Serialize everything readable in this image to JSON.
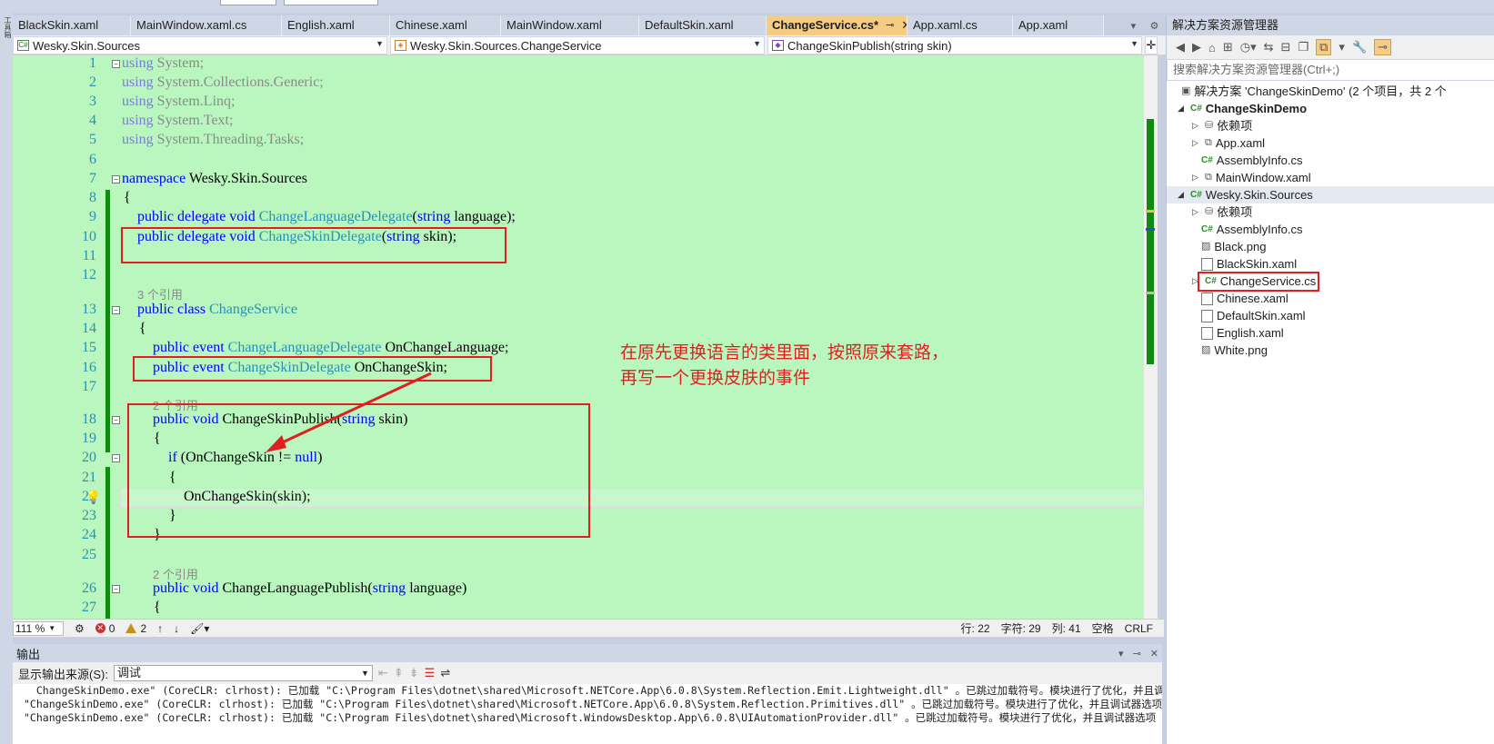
{
  "window": {
    "left_toolbar_label": "工具箱"
  },
  "tabs": [
    {
      "label": "BlackSkin.xaml",
      "active": false
    },
    {
      "label": "MainWindow.xaml.cs",
      "active": false
    },
    {
      "label": "English.xaml",
      "active": false
    },
    {
      "label": "Chinese.xaml",
      "active": false
    },
    {
      "label": "MainWindow.xaml",
      "active": false
    },
    {
      "label": "DefaultSkin.xaml",
      "active": false
    },
    {
      "label": "ChangeService.cs*",
      "active": true
    },
    {
      "label": "App.xaml.cs",
      "active": false
    },
    {
      "label": "App.xaml",
      "active": false
    }
  ],
  "navbar": {
    "project": "Wesky.Skin.Sources",
    "class": "Wesky.Skin.Sources.ChangeService",
    "member": "ChangeSkinPublish(string skin)"
  },
  "code": {
    "line_numbers": [
      "1",
      "2",
      "3",
      "4",
      "5",
      "6",
      "7",
      "8",
      "9",
      "10",
      "11",
      "12",
      "13",
      "14",
      "15",
      "16",
      "17",
      "18",
      "19",
      "20",
      "21",
      "22",
      "23",
      "24",
      "25",
      "26",
      "27"
    ],
    "l1_kw": "using",
    "l1_rest": " System;",
    "l2_kw": "using",
    "l2_rest": " System.Collections.Generic;",
    "l3_kw": "using",
    "l3_rest": " System.Linq;",
    "l4_kw": "using",
    "l4_rest": " System.Text;",
    "l5_kw": "using",
    "l5_rest": " System.Threading.Tasks;",
    "l7_kw": "namespace",
    "l7_rest": " Wesky.Skin.Sources",
    "l8": "{",
    "l9_kw": "public delegate void",
    "l9_type": "ChangeLanguageDelegate",
    "l9_p": "(",
    "l9_kw2": "string",
    "l9_rest": " language);",
    "l10_kw": "public delegate void",
    "l10_type": "ChangeSkinDelegate",
    "l10_p": "(",
    "l10_kw2": "string",
    "l10_rest": " skin);",
    "ref_class": "3 个引用",
    "l13_kw": "public class",
    "l13_type": "ChangeService",
    "l14": "{",
    "l15_kw": "public event",
    "l15_type": "ChangeLanguageDelegate",
    "l15_rest": " OnChangeLanguage;",
    "l16_kw": "public event",
    "l16_type": "ChangeSkinDelegate",
    "l16_rest": " OnChangeSkin;",
    "ref_publish": "2 个引用",
    "l18_kw": "public void",
    "l18_name": " ChangeSkinPublish(",
    "l18_kw2": "string",
    "l18_rest": " skin)",
    "l19": "{",
    "l20_kw": "if",
    "l20_mid": " (OnChangeSkin != ",
    "l20_kw2": "null",
    "l20_rest": ")",
    "l21": "{",
    "l22": "OnChangeSkin(skin);",
    "l23": "}",
    "l24": "}",
    "ref_lang": "2 个引用",
    "l26_kw": "public void",
    "l26_name": " ChangeLanguagePublish(",
    "l26_kw2": "string",
    "l26_rest": " language)",
    "l27": "{"
  },
  "annotation": {
    "line1": "在原先更换语言的类里面，按照原来套路，",
    "line2": "再写一个更换皮肤的事件",
    "color": "#e02020"
  },
  "status": {
    "zoom": "111 %",
    "errors": "0",
    "warnings": "2",
    "line": "行: 22",
    "char": "字符: 29",
    "col": "列: 41",
    "indent": "空格",
    "eol": "CRLF"
  },
  "output": {
    "title": "输出",
    "source_label": "显示输出来源(S):",
    "source_value": "调试",
    "lines": [
      "  ChangeSkinDemo.exe\" (CoreCLR: clrhost): 已加载 \"C:\\Program Files\\dotnet\\shared\\Microsoft.NETCore.App\\6.0.8\\System.Reflection.Emit.Lightweight.dll\" 。已跳过加载符号。模块进行了优化，并且调试器选项 \"仅我的代码\" 已启",
      "\"ChangeSkinDemo.exe\" (CoreCLR: clrhost): 已加载 \"C:\\Program Files\\dotnet\\shared\\Microsoft.NETCore.App\\6.0.8\\System.Reflection.Primitives.dll\" 。已跳过加载符号。模块进行了优化，并且调试器选项 \"仅我的代码\" 已启用。",
      "\"ChangeSkinDemo.exe\" (CoreCLR: clrhost): 已加载 \"C:\\Program Files\\dotnet\\shared\\Microsoft.WindowsDesktop.App\\6.0.8\\UIAutomationProvider.dll\" 。已跳过加载符号。模块进行了优化，并且调试器选项 \"仅我的代码\" 已启用"
    ]
  },
  "solution_explorer": {
    "title": "解决方案资源管理器",
    "search_placeholder": "搜索解决方案资源管理器(Ctrl+;)",
    "solution": "解决方案 'ChangeSkinDemo' (2 个项目，共 2 个",
    "items": [
      {
        "label": "ChangeSkinDemo",
        "bold": true
      },
      {
        "label": "依赖项"
      },
      {
        "label": "App.xaml"
      },
      {
        "label": "AssemblyInfo.cs"
      },
      {
        "label": "MainWindow.xaml"
      },
      {
        "label": "Wesky.Skin.Sources"
      },
      {
        "label": "依赖项"
      },
      {
        "label": "AssemblyInfo.cs"
      },
      {
        "label": "Black.png"
      },
      {
        "label": "BlackSkin.xaml"
      },
      {
        "label": "ChangeService.cs"
      },
      {
        "label": "Chinese.xaml"
      },
      {
        "label": "DefaultSkin.xaml"
      },
      {
        "label": "English.xaml"
      },
      {
        "label": "White.png"
      }
    ]
  }
}
